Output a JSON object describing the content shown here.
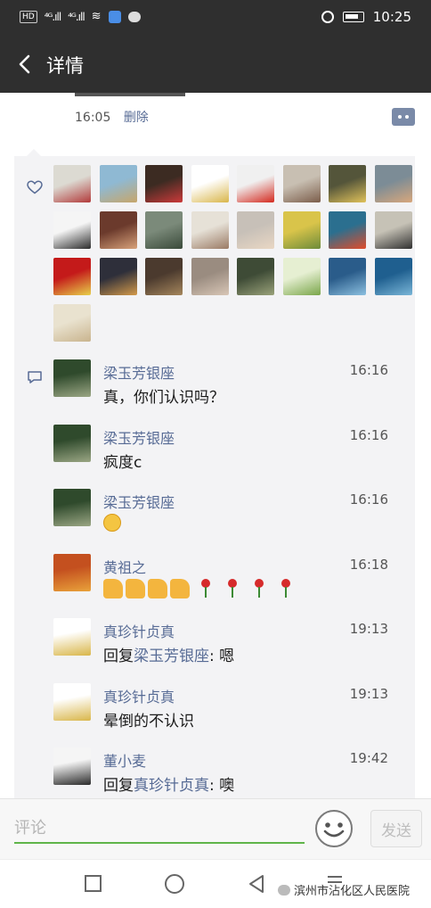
{
  "status_bar": {
    "network_label": "HD",
    "signal_1": "⁴ᴳ.ıll",
    "signal_2": "⁴ᴳ.ıll",
    "time": "10:25"
  },
  "header": {
    "title": "详情"
  },
  "post": {
    "time": "16:05",
    "delete_label": "删除"
  },
  "likes": {
    "avatars": [
      {
        "name": "avatar-1",
        "colors": [
          "#dcdad2",
          "#b23a3a"
        ]
      },
      {
        "name": "avatar-2",
        "colors": [
          "#8fb9d3",
          "#c7a66a"
        ]
      },
      {
        "name": "avatar-3",
        "colors": [
          "#3c2b22",
          "#cc3a3a"
        ]
      },
      {
        "name": "avatar-4",
        "colors": [
          "#ffffff",
          "#d9b64a"
        ]
      },
      {
        "name": "avatar-5",
        "colors": [
          "#f0f0f0",
          "#d42a1f"
        ]
      },
      {
        "name": "avatar-6",
        "colors": [
          "#c8bfb2",
          "#7b5d4a"
        ]
      },
      {
        "name": "avatar-7",
        "colors": [
          "#54553a",
          "#e0c25a"
        ]
      },
      {
        "name": "avatar-8",
        "colors": [
          "#7c8c96",
          "#d8a77c"
        ]
      },
      {
        "name": "avatar-9",
        "colors": [
          "#f5f5f5",
          "#2b2b2b"
        ]
      },
      {
        "name": "avatar-10",
        "colors": [
          "#6b3a2c",
          "#d8a27b"
        ]
      },
      {
        "name": "avatar-11",
        "colors": [
          "#7b8a7a",
          "#3a4a3a"
        ]
      },
      {
        "name": "avatar-12",
        "colors": [
          "#e6e1d7",
          "#9a7a64"
        ]
      },
      {
        "name": "avatar-13",
        "colors": [
          "#c7c0b8",
          "#e9d7c4"
        ]
      },
      {
        "name": "avatar-14",
        "colors": [
          "#d9c44a",
          "#6d8b3a"
        ]
      },
      {
        "name": "avatar-15",
        "colors": [
          "#2b6f8f",
          "#e24c2a"
        ]
      },
      {
        "name": "avatar-16",
        "colors": [
          "#c6c2b6",
          "#303030"
        ]
      },
      {
        "name": "avatar-17",
        "colors": [
          "#c41a1a",
          "#e7d04a"
        ]
      },
      {
        "name": "avatar-18",
        "colors": [
          "#2e2f3a",
          "#d49a4a"
        ]
      },
      {
        "name": "avatar-19",
        "colors": [
          "#4b3a2e",
          "#a5865c"
        ]
      },
      {
        "name": "avatar-20",
        "colors": [
          "#9a8c80",
          "#d8c6b6"
        ]
      },
      {
        "name": "avatar-21",
        "colors": [
          "#3e4b36",
          "#9aa27a"
        ]
      },
      {
        "name": "avatar-22",
        "colors": [
          "#e6efd2",
          "#7aa64a"
        ]
      },
      {
        "name": "avatar-23",
        "colors": [
          "#2a5c8a",
          "#8cc0e0"
        ]
      },
      {
        "name": "avatar-24",
        "colors": [
          "#1f5f8f",
          "#7ab6d8"
        ]
      },
      {
        "name": "avatar-25",
        "colors": [
          "#e9e2cf",
          "#c9b48e"
        ]
      }
    ]
  },
  "comments": [
    {
      "author": "梁玉芳银座",
      "time": "16:16",
      "text": "真，你们认识吗？",
      "avatar_colors": [
        "#2f4a2c",
        "#9aa684"
      ]
    },
    {
      "author": "梁玉芳银座",
      "time": "16:16",
      "text": "疯度c",
      "avatar_colors": [
        "#2f4a2c",
        "#9aa684"
      ]
    },
    {
      "author": "梁玉芳银座",
      "time": "16:16",
      "text": "",
      "emoji": "tongue-out-emoji",
      "avatar_colors": [
        "#2f4a2c",
        "#9aa684"
      ]
    },
    {
      "author": "黄祖之",
      "time": "16:18",
      "text": "",
      "emoji": "thumbs-up-and-roses",
      "avatar_colors": [
        "#c4501f",
        "#e9a23a"
      ]
    },
    {
      "author": "真珍针贞真",
      "time": "19:13",
      "reply_prefix": "回复",
      "reply_to": "梁玉芳银座",
      "text": ": 嗯",
      "avatar_colors": [
        "#ffffff",
        "#d9b64a"
      ]
    },
    {
      "author": "真珍针贞真",
      "time": "19:13",
      "text": "晕倒的不认识",
      "avatar_colors": [
        "#ffffff",
        "#d9b64a"
      ]
    },
    {
      "author": "董小麦",
      "time": "19:42",
      "reply_prefix": "回复",
      "reply_to": "真珍针贞真",
      "text": ": 噢",
      "avatar_colors": [
        "#f5f5f5",
        "#2b2b2b"
      ]
    }
  ],
  "input": {
    "placeholder": "评论",
    "send_label": "发送"
  },
  "system_nav": {
    "watermark": "滨州市沾化区人民医院"
  },
  "colors": {
    "header_bg": "#2f2f2f",
    "name_link": "#576b95",
    "panel_bg": "#f3f3f5",
    "input_underline": "#5fb54a"
  }
}
